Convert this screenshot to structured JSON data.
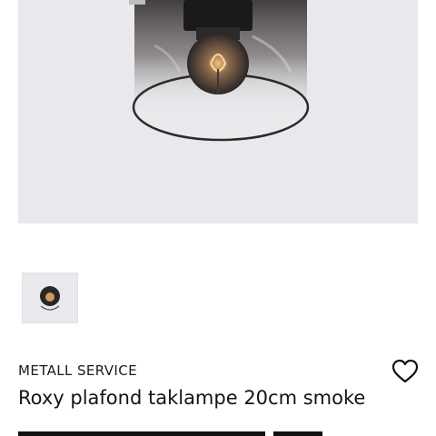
{
  "product": {
    "brand": "METALL SERVICE",
    "title": "Roxy plafond taklampe 20cm smoke"
  },
  "gallery": {
    "main_image": "lamp-photo",
    "thumbnails": [
      "lamp-thumbnail"
    ]
  },
  "icons": {
    "favorite": "heart-outline-icon"
  },
  "colors": {
    "image_background": "#e9e8ec",
    "text": "#141414",
    "button": "#111111"
  }
}
